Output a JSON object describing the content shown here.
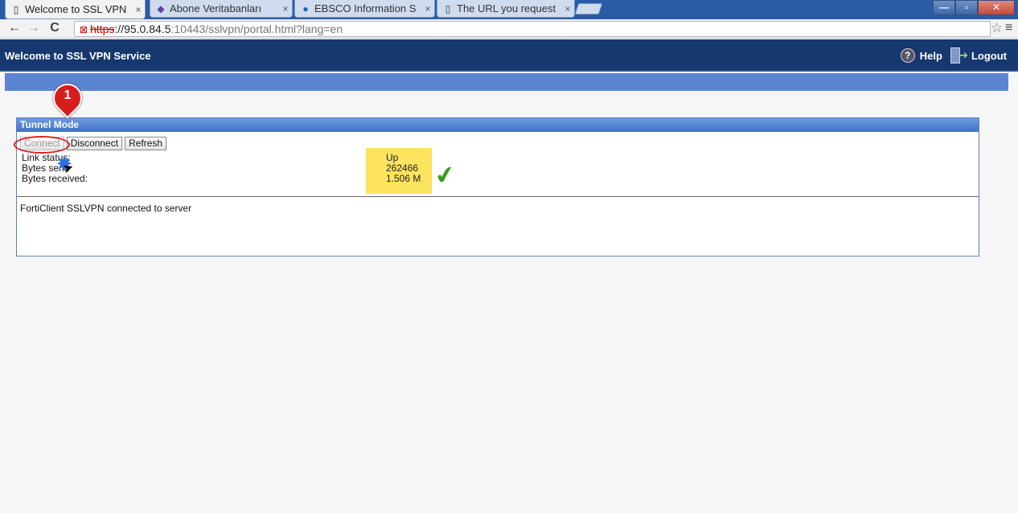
{
  "browser": {
    "tabs": [
      {
        "title": "Welcome to SSL VPN",
        "icon": "page-icon",
        "close": "×"
      },
      {
        "title": "Abone Veritabanları",
        "icon": "diamond-icon",
        "close": "×"
      },
      {
        "title": "EBSCO Information S",
        "icon": "ebsco-icon",
        "close": "×"
      },
      {
        "title": "The URL you request",
        "icon": "page-icon",
        "close": "×"
      }
    ],
    "window_controls": {
      "minimize": "—",
      "maximize": "▫",
      "close": "✕"
    },
    "back": "←",
    "forward": "→",
    "reload": "C",
    "url_protocol": "https",
    "url_host": "://95.0.84.5",
    "url_path": ":10443/sslvpn/portal.html?lang=en",
    "star": "☆",
    "menu": "≡"
  },
  "header": {
    "title": "Welcome to SSL VPN Service",
    "help_label": "Help",
    "logout_label": "Logout"
  },
  "panel": {
    "title": "Tunnel Mode",
    "buttons": {
      "connect": "Connect",
      "disconnect": "Disconnect",
      "refresh": "Refresh"
    },
    "labels": {
      "link_status": "Link status:",
      "bytes_sent": "Bytes sent:",
      "bytes_received": "Bytes received:"
    },
    "values": {
      "link_status": "Up",
      "bytes_sent": "262466",
      "bytes_received": "1.506 M"
    },
    "message": "FortiClient SSLVPN connected to server"
  },
  "annotation": {
    "step_number": "1",
    "status_color": "#fce45e",
    "accent": "#d61d1d"
  }
}
